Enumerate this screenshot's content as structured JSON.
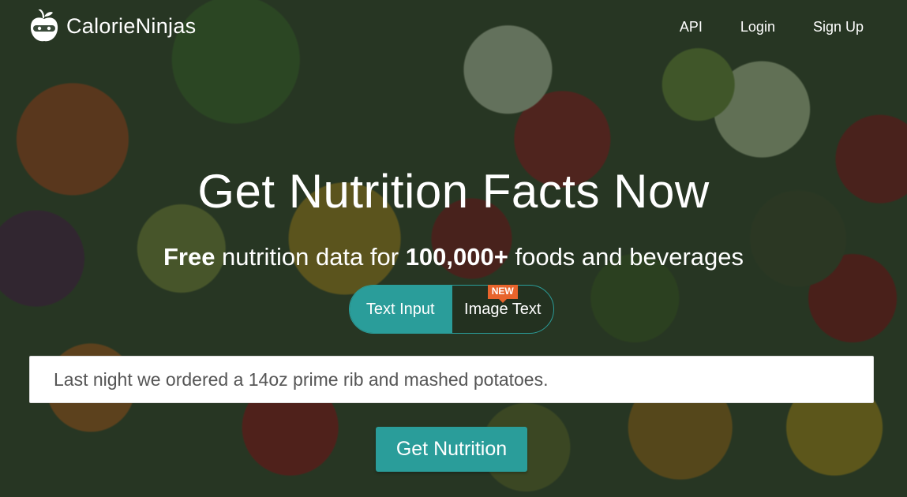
{
  "brand": {
    "name": "CalorieNinjas",
    "logo_icon": "ninja-apple-icon"
  },
  "nav": {
    "links": [
      "API",
      "Login",
      "Sign Up"
    ]
  },
  "hero": {
    "title": "Get Nutrition Facts Now",
    "subtitle": {
      "free": "Free",
      "part1": " nutrition data for ",
      "count": "100,000+",
      "part2": " foods and beverages"
    }
  },
  "mode_toggle": {
    "options": [
      "Text Input",
      "Image Text"
    ],
    "selected": "Text Input",
    "new_badge": "NEW"
  },
  "query": {
    "value": "Last night we ordered a 14oz prime rib and mashed potatoes."
  },
  "submit": {
    "label": "Get Nutrition"
  },
  "colors": {
    "accent": "#2a9d9a",
    "badge": "#e8642c"
  }
}
